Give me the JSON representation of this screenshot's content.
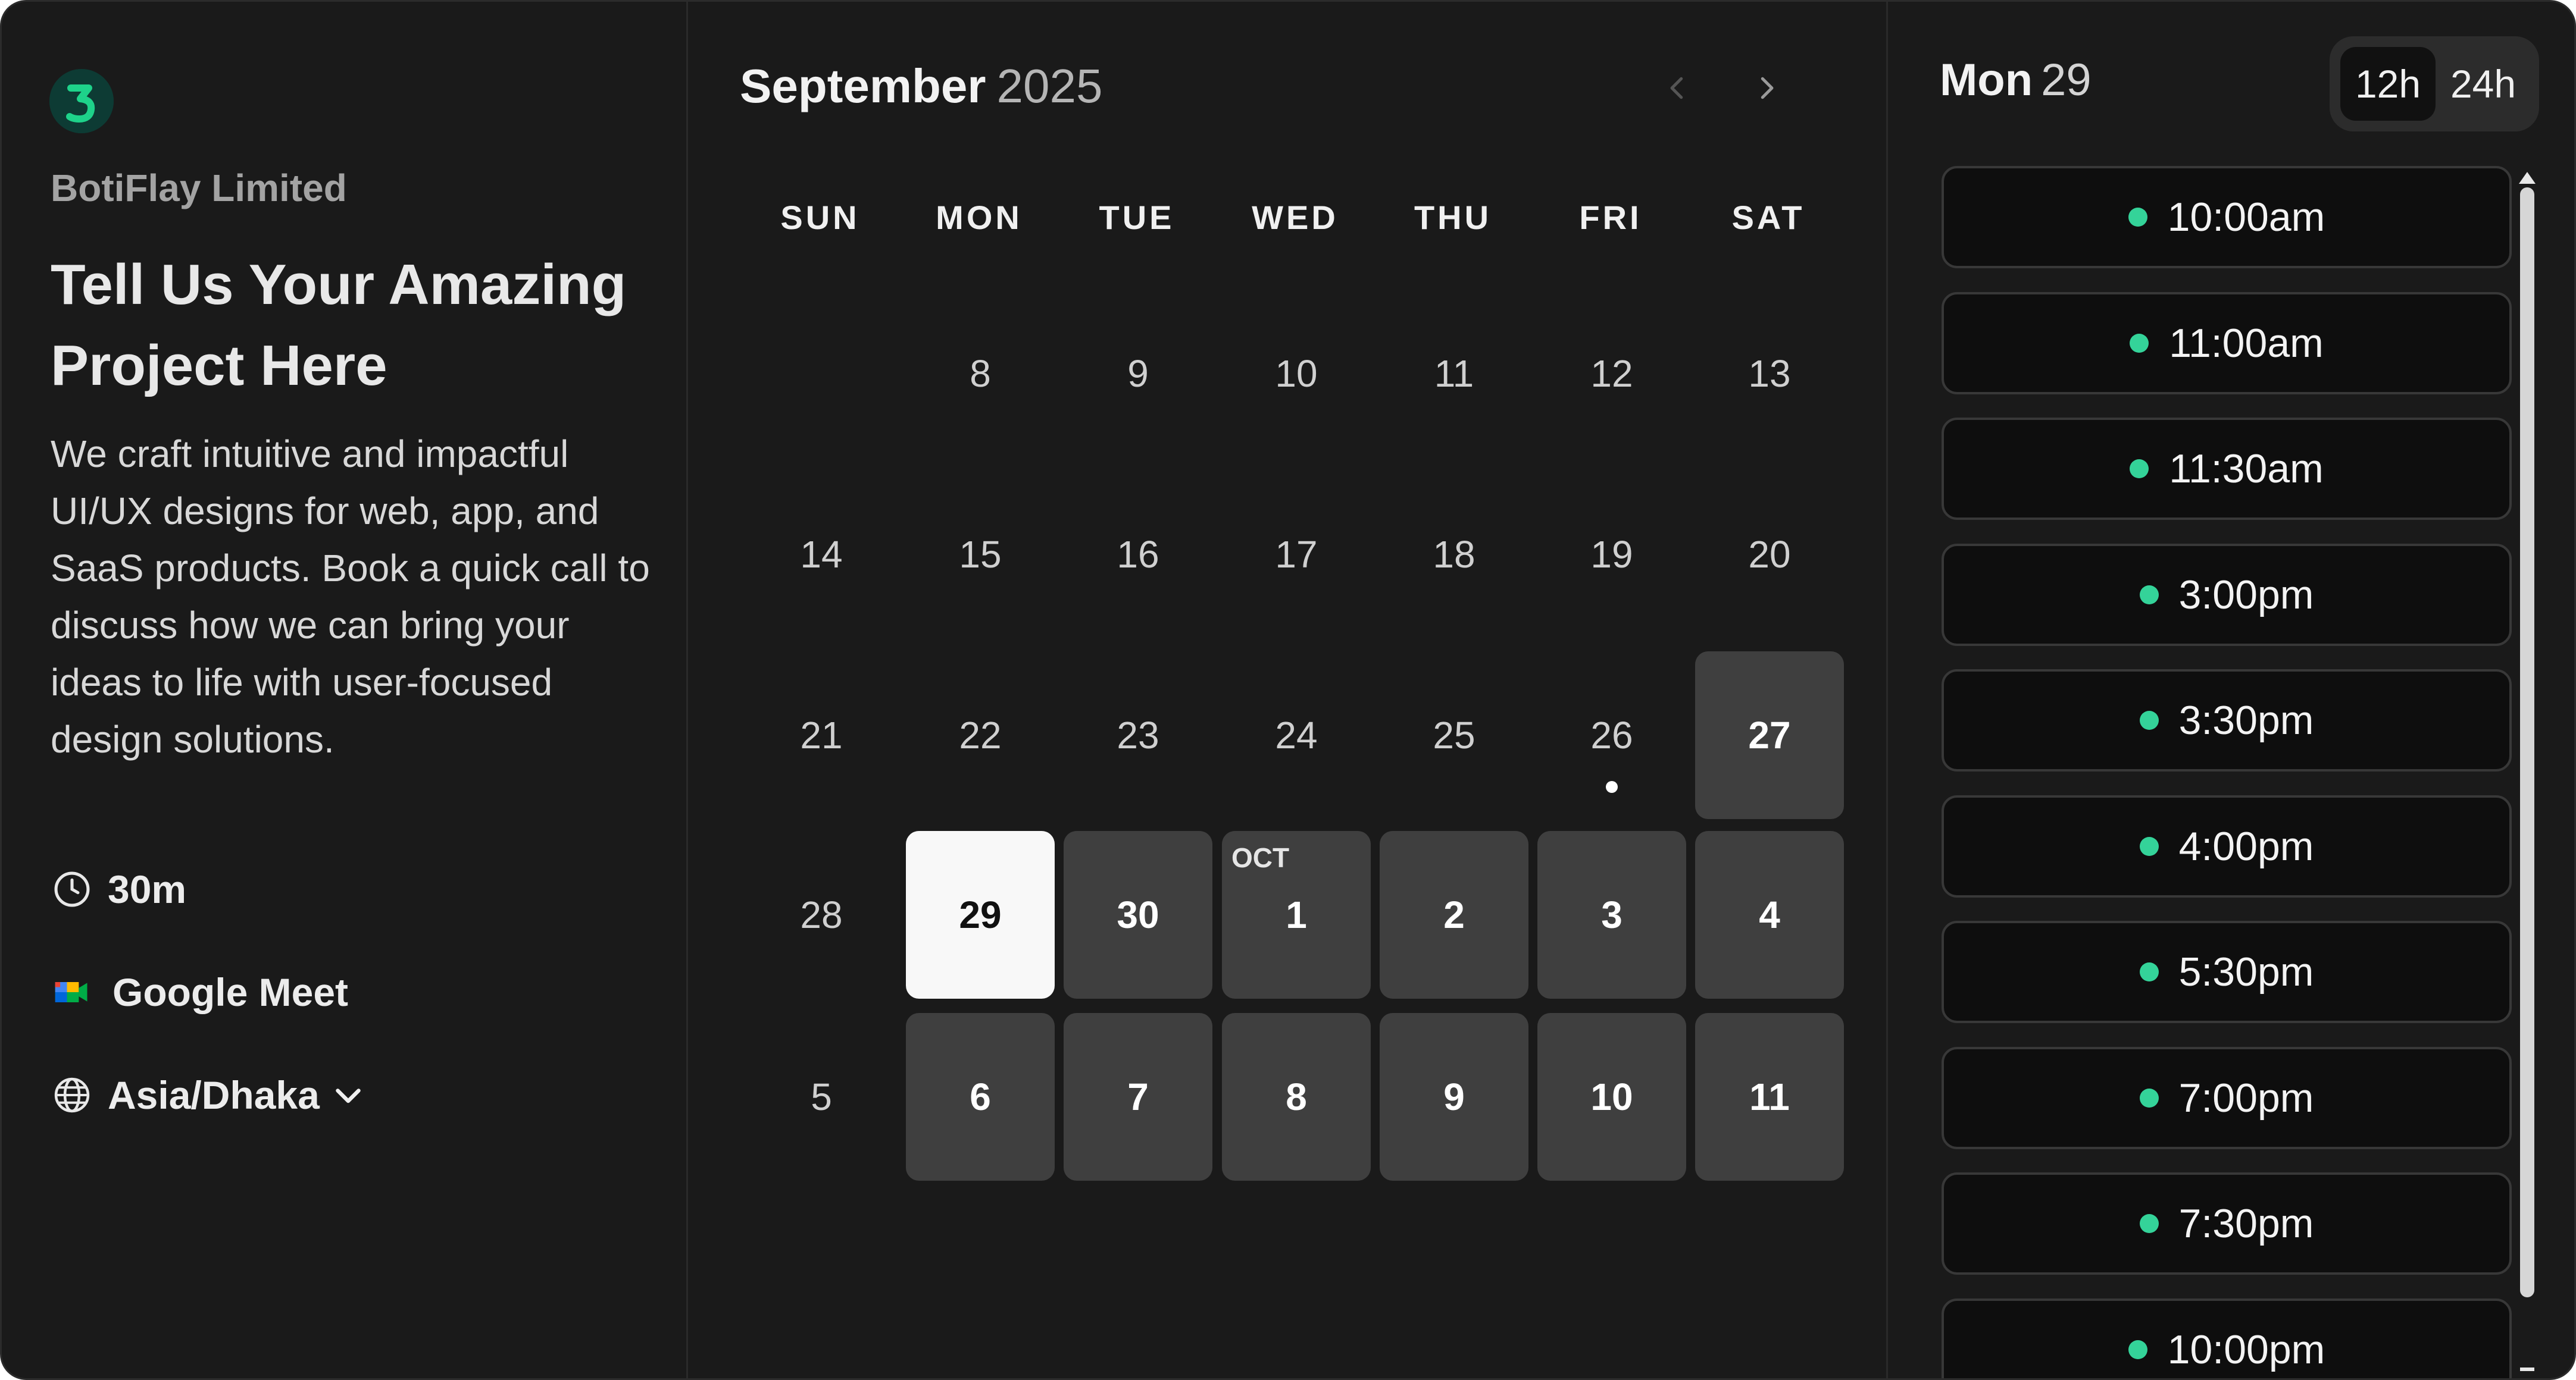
{
  "company": {
    "name": "BotiFlay Limited",
    "logo_letter": "3",
    "logo_colors": {
      "background": "#0d3b34",
      "glyph": "#1ed28a"
    }
  },
  "event": {
    "headline": "Tell Us Your Amazing Project Here",
    "description": "We craft intuitive and impactful UI/UX designs for web, app, and SaaS products. Book a quick call to discuss how we can bring your ideas to life with user-focused design solutions.",
    "duration": "30m",
    "location": "Google Meet",
    "timezone": "Asia/Dhaka",
    "icons": {
      "duration": "clock-icon",
      "location": "google-meet-icon",
      "timezone": "globe-icon",
      "timezone_dropdown": "chevron-down-icon"
    }
  },
  "calendar": {
    "month": "September",
    "year": "2025",
    "nav": {
      "prev": "chevron-left-icon",
      "next": "chevron-right-icon"
    },
    "weekdays": [
      "SUN",
      "MON",
      "TUE",
      "WED",
      "THU",
      "FRI",
      "SAT"
    ],
    "weeks": [
      [
        {
          "label": ""
        },
        {
          "label": "8"
        },
        {
          "label": "9"
        },
        {
          "label": "10"
        },
        {
          "label": "11"
        },
        {
          "label": "12"
        },
        {
          "label": "13"
        }
      ],
      [
        {
          "label": "14"
        },
        {
          "label": "15"
        },
        {
          "label": "16"
        },
        {
          "label": "17"
        },
        {
          "label": "18"
        },
        {
          "label": "19"
        },
        {
          "label": "20"
        }
      ],
      [
        {
          "label": "21"
        },
        {
          "label": "22"
        },
        {
          "label": "23"
        },
        {
          "label": "24"
        },
        {
          "label": "25"
        },
        {
          "label": "26",
          "today_dot": true
        },
        {
          "label": "27",
          "available": true
        }
      ],
      [
        {
          "label": "28"
        },
        {
          "label": "29",
          "available": true,
          "selected": true
        },
        {
          "label": "30",
          "available": true
        },
        {
          "label": "1",
          "available": true,
          "month_tag": "OCT"
        },
        {
          "label": "2",
          "available": true
        },
        {
          "label": "3",
          "available": true
        },
        {
          "label": "4",
          "available": true
        }
      ],
      [
        {
          "label": "5"
        },
        {
          "label": "6",
          "available": true
        },
        {
          "label": "7",
          "available": true
        },
        {
          "label": "8",
          "available": true
        },
        {
          "label": "9",
          "available": true
        },
        {
          "label": "10",
          "available": true
        },
        {
          "label": "11",
          "available": true
        }
      ]
    ]
  },
  "slots_panel": {
    "day_name": "Mon",
    "day_number": "29",
    "format_12h": "12h",
    "format_24h": "24h",
    "active_format": "12h",
    "available_color": "#34d399",
    "slots": [
      "10:00am",
      "11:00am",
      "11:30am",
      "3:00pm",
      "3:30pm",
      "4:00pm",
      "5:30pm",
      "7:00pm",
      "7:30pm",
      "10:00pm"
    ]
  }
}
